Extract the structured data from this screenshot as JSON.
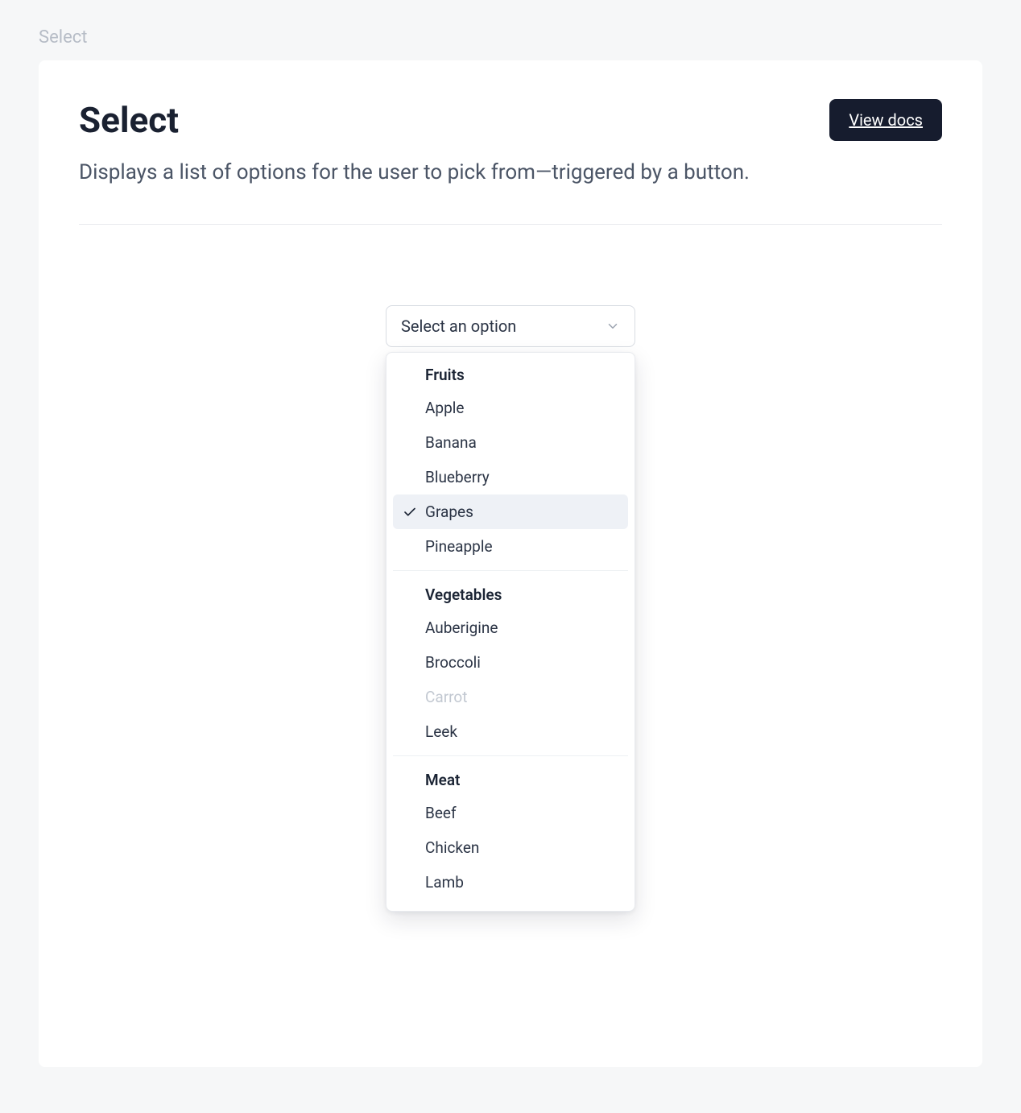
{
  "breadcrumb": "Select",
  "header": {
    "title": "Select",
    "view_docs_label": "View docs"
  },
  "description": "Displays a list of options for the user to pick from—triggered by a button.",
  "select": {
    "trigger_label": "Select an option",
    "groups": [
      {
        "label": "Fruits",
        "options": [
          {
            "label": "Apple",
            "selected": false,
            "disabled": false
          },
          {
            "label": "Banana",
            "selected": false,
            "disabled": false
          },
          {
            "label": "Blueberry",
            "selected": false,
            "disabled": false
          },
          {
            "label": "Grapes",
            "selected": true,
            "disabled": false
          },
          {
            "label": "Pineapple",
            "selected": false,
            "disabled": false
          }
        ]
      },
      {
        "label": "Vegetables",
        "options": [
          {
            "label": "Auberigine",
            "selected": false,
            "disabled": false
          },
          {
            "label": "Broccoli",
            "selected": false,
            "disabled": false
          },
          {
            "label": "Carrot",
            "selected": false,
            "disabled": true
          },
          {
            "label": "Leek",
            "selected": false,
            "disabled": false
          }
        ]
      },
      {
        "label": "Meat",
        "options": [
          {
            "label": "Beef",
            "selected": false,
            "disabled": false
          },
          {
            "label": "Chicken",
            "selected": false,
            "disabled": false
          },
          {
            "label": "Lamb",
            "selected": false,
            "disabled": false
          }
        ]
      }
    ]
  }
}
